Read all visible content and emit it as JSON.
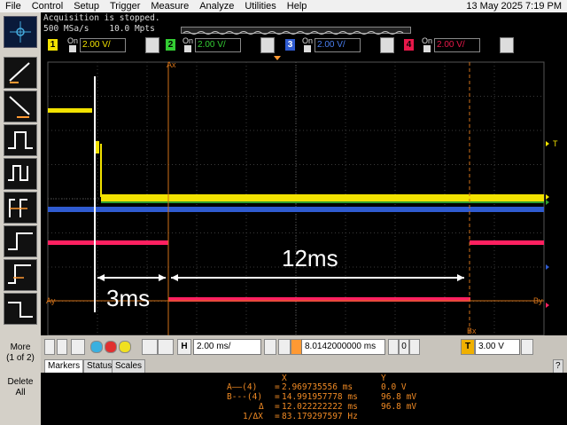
{
  "menu": [
    "File",
    "Control",
    "Setup",
    "Trigger",
    "Measure",
    "Analyze",
    "Utilities",
    "Help"
  ],
  "datetime": "13 May 2025  7:19 PM",
  "status": {
    "line1": "Acquisition is stopped.",
    "line2": "500 MSa/s    10.0 Mpts"
  },
  "channels": [
    {
      "num": "1",
      "on": "On",
      "scale": "2.00 V/",
      "color": "#f2e200"
    },
    {
      "num": "2",
      "on": "On",
      "scale": "2.00 V/",
      "color": "#33cc33"
    },
    {
      "num": "3",
      "on": "On",
      "scale": "2.00 V/",
      "color": "#2f5bd0"
    },
    {
      "num": "4",
      "on": "On",
      "scale": "2.00 V/",
      "color": "#e8184a"
    }
  ],
  "waveforms": {
    "yellow": "#f2e200",
    "green": "#2f9f2f",
    "blue": "#2f5bd0",
    "red": "#ff2060",
    "cursor": "#d07018",
    "annot": "#ffffff"
  },
  "cursor_labels": {
    "ax": "Ax",
    "bx": "Bx",
    "ay": "Ay",
    "by": "By",
    "t": "T"
  },
  "annotations": {
    "a": "3ms",
    "b": "12ms"
  },
  "controls": {
    "h_label": "H",
    "timebase": "2.00 ms/",
    "delay": "8.0142000000 ms",
    "trig_label": "T",
    "trig_level": "3.00 V",
    "zero": "0"
  },
  "side": {
    "more": "More",
    "more_sub": "(1 of 2)",
    "del": "Delete",
    "del_sub": "All"
  },
  "tabs": [
    "Markers",
    "Status",
    "Scales"
  ],
  "markers": {
    "header_x": "X",
    "header_y": "Y",
    "rows": [
      {
        "label": "A——(4)",
        "x": "2.969735556 ms",
        "y": "0.0 V"
      },
      {
        "label": "B---(4)",
        "x": "14.991957778 ms",
        "y": "96.8 mV"
      },
      {
        "label": "Δ",
        "x": "12.022222222 ms",
        "y": "96.8 mV"
      },
      {
        "label": "1/ΔX",
        "x": "83.179297597 Hz",
        "y": ""
      }
    ]
  }
}
